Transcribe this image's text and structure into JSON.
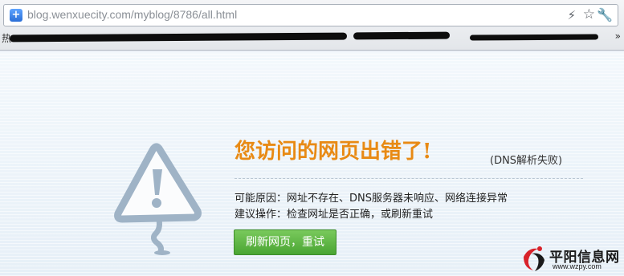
{
  "browser": {
    "url": "blog.wenxuecity.com/myblog/8786/all.html",
    "bookmark_label": "热",
    "icons": {
      "site": "plus-icon",
      "flash": "lightning-icon",
      "star": "star-icon",
      "wrench": "wrench-icon",
      "bookmarks_overflow": "chevron-right-icon"
    }
  },
  "error_page": {
    "title": "您访问的网页出错了!",
    "detail": "(DNS解析失败)",
    "reason": "可能原因：网址不存在、DNS服务器未响应、网络连接异常",
    "suggestion": "建议操作：检查网址是否正确，或刷新重试",
    "retry_button": "刷新网页，重试",
    "title_color": "#e88a14",
    "button_color": "#4aa533"
  },
  "watermark": {
    "name": "平阳信息网",
    "url": "www.wzpy.com"
  }
}
